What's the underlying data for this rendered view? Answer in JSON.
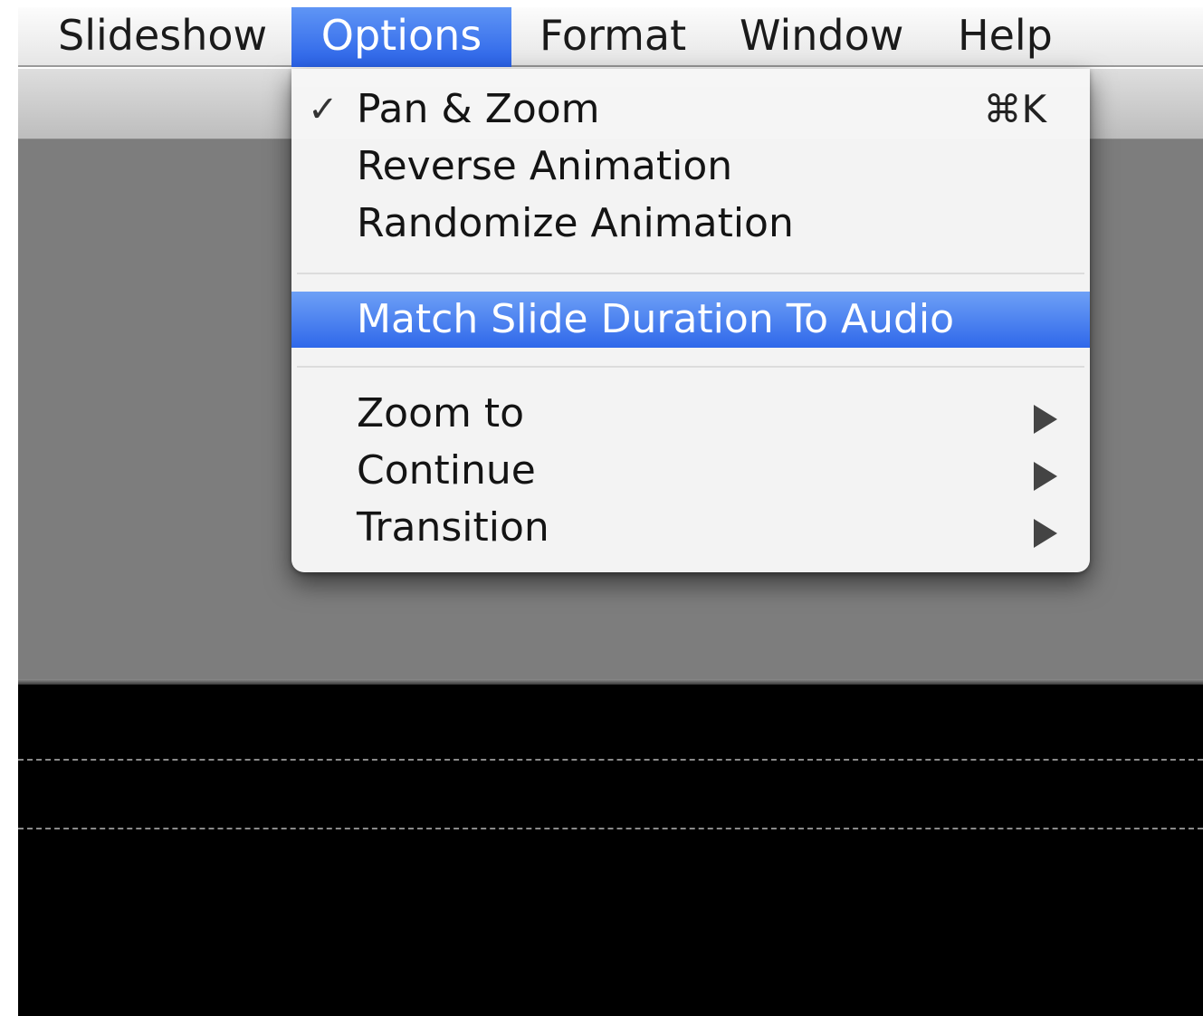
{
  "menubar": {
    "items": [
      {
        "label": "Slideshow",
        "active": false
      },
      {
        "label": "Options",
        "active": true
      },
      {
        "label": "Format",
        "active": false
      },
      {
        "label": "Window",
        "active": false
      },
      {
        "label": "Help",
        "active": false
      }
    ]
  },
  "dropdown": {
    "check_mark": "✓",
    "items": [
      {
        "label": "Pan & Zoom",
        "checked": true,
        "shortcut": "⌘K"
      },
      {
        "label": "Reverse Animation"
      },
      {
        "label": "Randomize Animation"
      },
      {
        "label": "Match Slide Duration To Audio",
        "highlighted": true
      },
      {
        "label": "Zoom to",
        "submenu": true
      },
      {
        "label": "Continue",
        "submenu": true
      },
      {
        "label": "Transition",
        "submenu": true
      }
    ]
  },
  "colors": {
    "highlight": "#2f68ea",
    "menu_background": "#f6f6f6",
    "canvas_gray": "#7d7d7d",
    "timeline": "#000000"
  },
  "icons": {
    "check": "checkmark-icon",
    "submenu": "submenu-arrow-icon",
    "shortcut": "command-key-icon"
  }
}
